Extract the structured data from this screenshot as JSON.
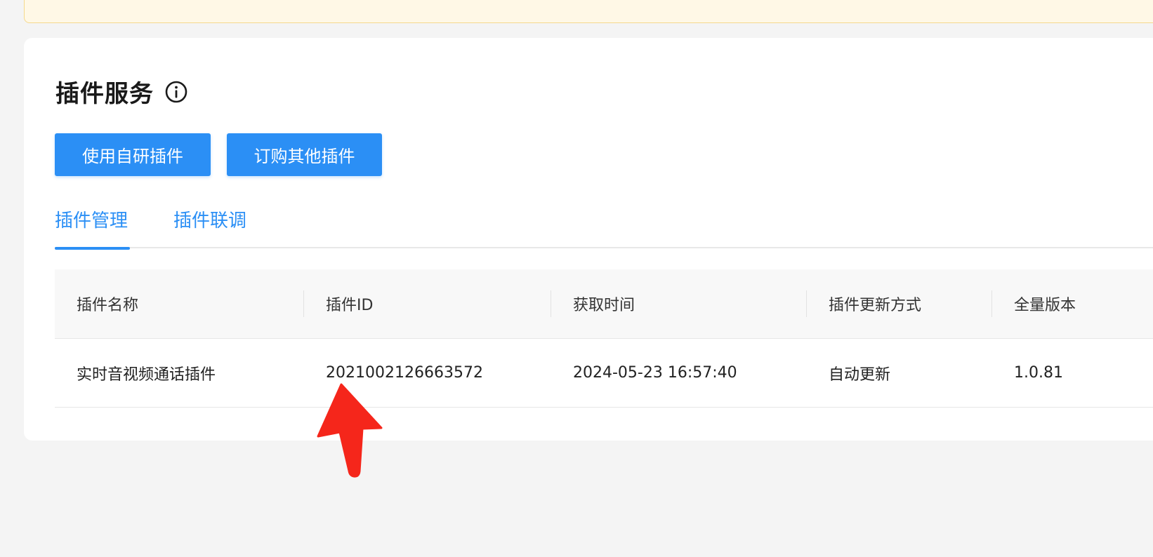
{
  "header": {
    "title": "插件服务",
    "info_icon": "info-circle-icon"
  },
  "actions": {
    "use_own_plugin": "使用自研插件",
    "order_other_plugin": "订购其他插件"
  },
  "tabs": [
    {
      "label": "插件管理",
      "active": true
    },
    {
      "label": "插件联调",
      "active": false
    }
  ],
  "table": {
    "columns": [
      "插件名称",
      "插件ID",
      "获取时间",
      "插件更新方式",
      "全量版本"
    ],
    "rows": [
      {
        "name": "实时音视频通话插件",
        "id": "2021002126663572",
        "time": "2024-05-23 16:57:40",
        "update_mode": "自动更新",
        "version": "1.0.81"
      }
    ]
  },
  "colors": {
    "accent": "#2b8ff5",
    "annotation_arrow": "#f5261b",
    "notice_bg": "#fff8e6"
  }
}
